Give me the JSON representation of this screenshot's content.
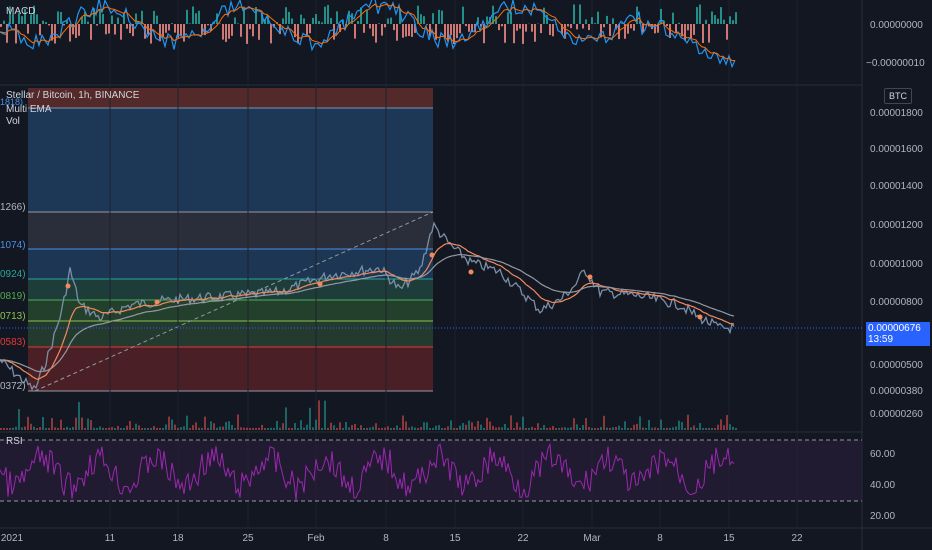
{
  "chart_header": {
    "symbol_line": "Stellar / Bitcoin, 1h, BINANCE",
    "indicator_1": "Multi EMA",
    "indicator_2": "Vol",
    "currency_button": "BTC",
    "partial_label_top": "1818)"
  },
  "macd_panel": {
    "label": "MACD",
    "ticks": [
      "0.00000000",
      "−0.00000010"
    ]
  },
  "rsi_panel": {
    "label": "RSI",
    "ticks": [
      "60.00",
      "40.00",
      "20.00"
    ]
  },
  "price_axis": {
    "ticks": [
      "0.00001800",
      "0.00001600",
      "0.00001400",
      "0.00001200",
      "0.00001000",
      "0.00000800",
      "0.00000500",
      "0.00000380",
      "0.00000260"
    ],
    "current_price": "0.00000676",
    "countdown": "13:59"
  },
  "fib_labels": [
    "1266)",
    "1074)",
    "0924)",
    "0819)",
    "0713)",
    "0583)",
    "0372)"
  ],
  "time_axis": [
    "2021",
    "11",
    "18",
    "25",
    "Feb",
    "8",
    "15",
    "22",
    "Mar",
    "8",
    "15",
    "22"
  ],
  "colors": {
    "background": "#131722",
    "price_candle": "#7b8fa6",
    "ema_orange": "#f48a5c",
    "ema_gray": "#9598a1",
    "rsi_line": "#9c27b0",
    "macd_line": "#2196f3",
    "macd_signal": "#ff6d00",
    "hist_up": "#26a69a",
    "hist_down": "#ef5350",
    "current_price_tag": "#2962ff"
  }
}
